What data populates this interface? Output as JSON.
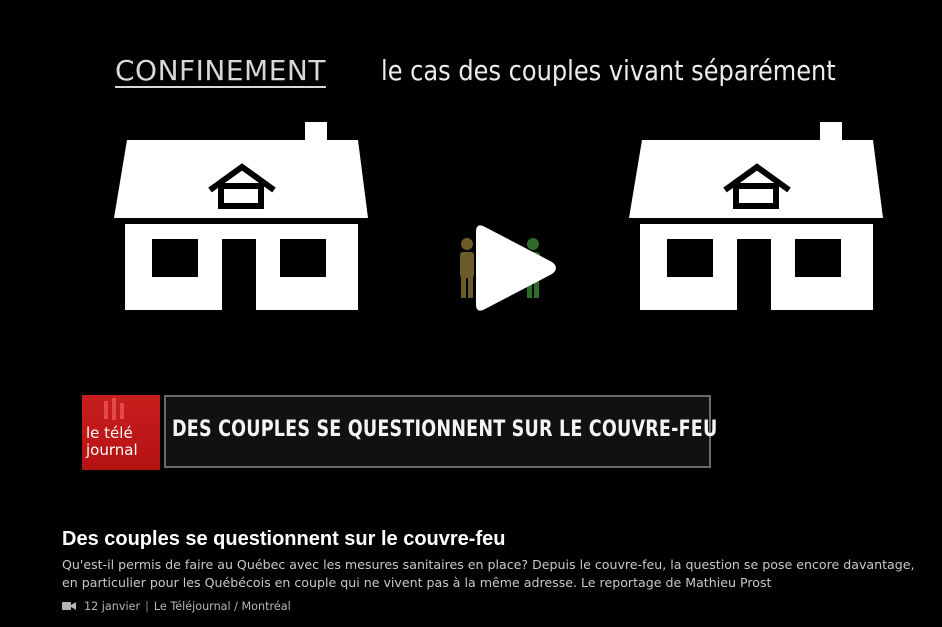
{
  "video": {
    "title_left": "CONFINEMENT",
    "title_right": "le cas des couples vivant séparément",
    "banner_text": "DES COUPLES SE QUESTIONNENT SUR LE COUVRE-FEU",
    "logo_line1": "le télé",
    "logo_line2": "journal",
    "play_icon": "play-icon"
  },
  "info": {
    "title": "Des couples se questionnent sur le couvre-feu",
    "description_line1": "Qu'est-il permis de faire au Québec avec les mesures sanitaires en place? Depuis le couvre-feu, la question se pose encore davantage,",
    "description_line2": "en particulier pour les Québécois en couple qui ne vivent pas à la même adresse. Le reportage de Mathieu Prost",
    "date": "12 janvier",
    "separator": "|",
    "program": "Le Téléjournal / Montréal",
    "meta_icon": "video-camera-icon"
  },
  "colors": {
    "background": "#000000",
    "logo_red": "#c81e1e",
    "house_white": "#ffffff"
  }
}
